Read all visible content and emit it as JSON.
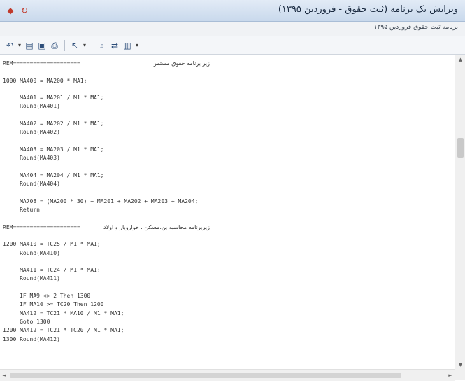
{
  "window": {
    "title": "ویرایش یک برنامه (ثبت حقوق - فروردین ۱۳۹۵)",
    "subtitle": "برنامه ثبت حقوق فروردین ۱۳۹۵"
  },
  "quick_access": [
    "app-icon",
    "refresh-icon"
  ],
  "toolbar": {
    "icons": [
      "undo-icon",
      "open-icon",
      "save-icon",
      "print-icon",
      "cursor-icon",
      "find-icon",
      "replace-icon",
      "dropdown-menu-icon"
    ]
  },
  "editor": {
    "lines": [
      {
        "code": "REM====================",
        "comment": "زیر برنامه حقوق مستمر"
      },
      {
        "code": ""
      },
      {
        "code": "1000 MA400 = MA200 * MA1;"
      },
      {
        "code": ""
      },
      {
        "code": "     MA401 = MA201 / M1 * MA1;"
      },
      {
        "code": "     Round(MA401)"
      },
      {
        "code": ""
      },
      {
        "code": "     MA402 = MA202 / M1 * MA1;"
      },
      {
        "code": "     Round(MA402)"
      },
      {
        "code": ""
      },
      {
        "code": "     MA403 = MA203 / M1 * MA1;"
      },
      {
        "code": "     Round(MA403)"
      },
      {
        "code": ""
      },
      {
        "code": "     MA404 = MA204 / M1 * MA1;"
      },
      {
        "code": "     Round(MA404)"
      },
      {
        "code": ""
      },
      {
        "code": "     MA708 = (MA200 * 30) + MA201 + MA202 + MA203 + MA204;"
      },
      {
        "code": "     Return"
      },
      {
        "code": ""
      },
      {
        "code": "REM====================",
        "comment": "زیربرنامه محاسبه بن،مسکن ، خواروبار و اولاد"
      },
      {
        "code": ""
      },
      {
        "code": "1200 MA410 = TC25 / M1 * MA1;"
      },
      {
        "code": "     Round(MA410)"
      },
      {
        "code": ""
      },
      {
        "code": "     MA411 = TC24 / M1 * MA1;"
      },
      {
        "code": "     Round(MA411)"
      },
      {
        "code": ""
      },
      {
        "code": "     IF MA9 <> 2 Then 1300"
      },
      {
        "code": "     IF MA10 >= TC20 Then 1200"
      },
      {
        "code": "     MA412 = TC21 * MA10 / M1 * MA1;"
      },
      {
        "code": "     Goto 1300"
      },
      {
        "code": "1200 MA412 = TC21 * TC20 / M1 * MA1;"
      },
      {
        "code": "1300 Round(MA412)"
      }
    ]
  },
  "scrollbars": {
    "vertical_arrows": [
      "▲",
      "▼"
    ],
    "horizontal_arrows": [
      "◄",
      "►"
    ]
  }
}
